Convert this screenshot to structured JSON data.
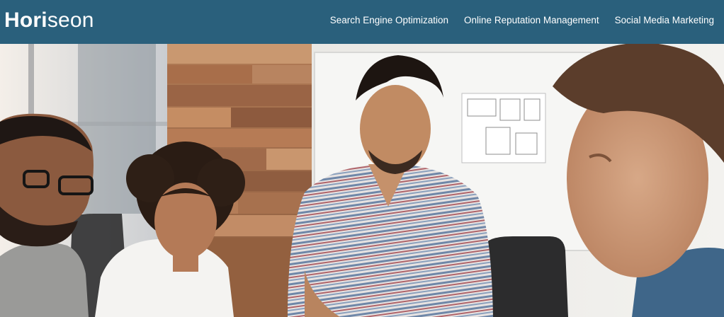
{
  "header": {
    "logo_bold": "Hori",
    "logo_light": "seon",
    "background_color": "#2a607c",
    "text_color": "#ffffff"
  },
  "nav": {
    "items": [
      {
        "label": "Search Engine Optimization"
      },
      {
        "label": "Online Reputation Management"
      },
      {
        "label": "Social Media Marketing"
      }
    ]
  },
  "hero": {
    "image_description": "hero-photo-team-meeting"
  }
}
